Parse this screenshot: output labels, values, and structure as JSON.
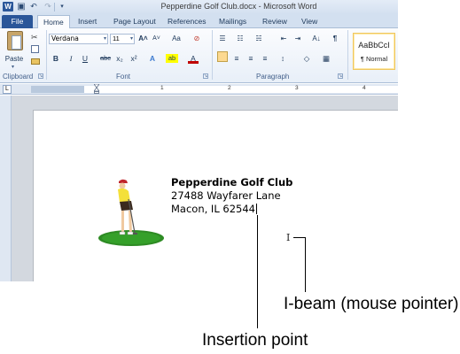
{
  "window": {
    "title": "Pepperdine Golf Club.docx - Microsoft Word",
    "qat": {
      "logo_glyph": "W",
      "save_glyph": "▣",
      "undo_glyph": "↶",
      "redo_glyph": "↷",
      "customize_glyph": "▾"
    }
  },
  "tabs": [
    {
      "label": "File"
    },
    {
      "label": "Home"
    },
    {
      "label": "Insert"
    },
    {
      "label": "Page Layout"
    },
    {
      "label": "References"
    },
    {
      "label": "Mailings"
    },
    {
      "label": "Review"
    },
    {
      "label": "View"
    }
  ],
  "ribbon": {
    "clipboard": {
      "paste_label": "Paste",
      "group_label": "Clipboard"
    },
    "font": {
      "font_name": "Verdana",
      "font_size": "11",
      "grow_label": "A˄",
      "shrink_label": "A˅",
      "change_case_label": "Aa",
      "clear_format_label": "⊘",
      "bold_label": "B",
      "italic_label": "I",
      "underline_label": "U",
      "strikethrough_label": "abc",
      "subscript_label": "x₂",
      "superscript_label": "x²",
      "text_effects_label": "A",
      "highlight_label": "ab",
      "font_color_label": "A",
      "group_label": "Font"
    },
    "paragraph": {
      "bullets_glyph": "☰",
      "numbering_glyph": "☷",
      "multilevel_glyph": "☵",
      "decrease_indent_glyph": "⇤",
      "increase_indent_glyph": "⇥",
      "sort_glyph": "A↓",
      "show_marks_glyph": "¶",
      "line_spacing_glyph": "↕",
      "shading_glyph": "◇",
      "borders_glyph": "▦",
      "group_label": "Paragraph"
    },
    "styles": {
      "sample": "AaBbCcI",
      "name": "¶ Normal"
    }
  },
  "ruler": {
    "tab_selector": "L",
    "numbers": [
      "1",
      "2",
      "3",
      "4"
    ]
  },
  "document": {
    "lines": [
      "Pepperdine Golf Club",
      "27488 Wayfarer Lane",
      "Macon, IL 62544"
    ]
  },
  "callouts": {
    "ibeam": "I-beam (mouse pointer)",
    "insertion": "Insertion point"
  },
  "colors": {
    "file_tab": "#2a5699",
    "ribbon_bg": "#e8eff8",
    "style_highlight": "#f0c75f",
    "golf_green": "#2e8b24"
  }
}
